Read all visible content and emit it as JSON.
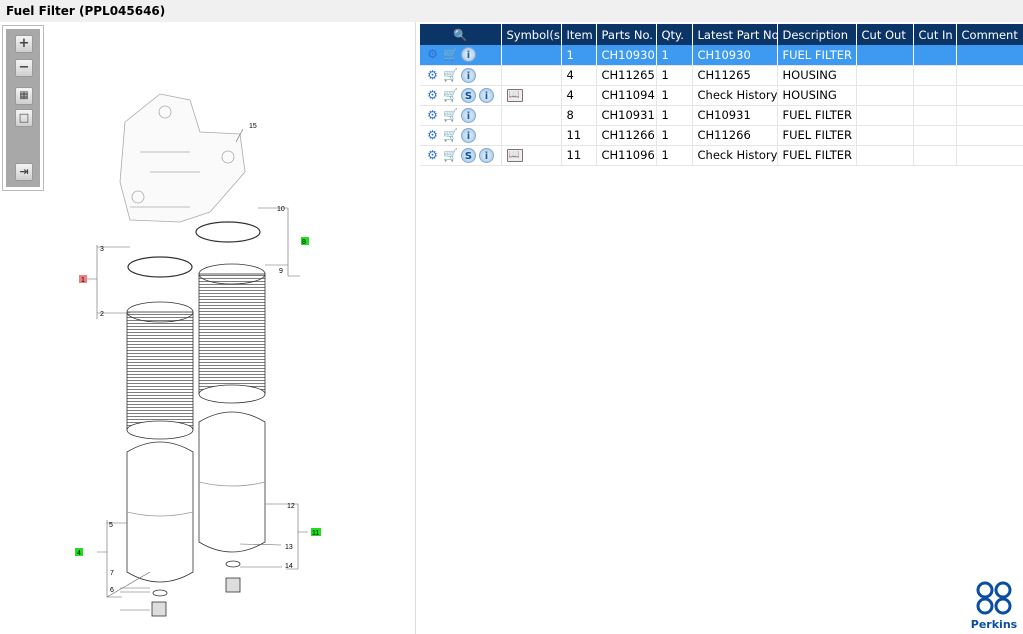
{
  "window": {
    "title": "Fuel Filter (PPL045646)"
  },
  "toolbar": {
    "zoom_in": "+",
    "zoom_out": "−",
    "fit": "▦",
    "actual": "□",
    "export": "⇥"
  },
  "table": {
    "columns": [
      "",
      "Symbol(s)",
      "Item",
      "Parts No.",
      "Qty.",
      "Latest Part No.",
      "Description",
      "Cut Out",
      "Cut In",
      "Comment"
    ],
    "rows": [
      {
        "selected": true,
        "s_icon": false,
        "symbol": false,
        "item": "1",
        "part": "CH10930",
        "qty": "1",
        "latest": "CH10930",
        "desc": "FUEL FILTER"
      },
      {
        "selected": false,
        "s_icon": false,
        "symbol": false,
        "item": "4",
        "part": "CH11265",
        "qty": "1",
        "latest": "CH11265",
        "desc": "HOUSING"
      },
      {
        "selected": false,
        "s_icon": true,
        "symbol": true,
        "item": "4",
        "part": "CH11094",
        "qty": "1",
        "latest": "Check History",
        "desc": "HOUSING"
      },
      {
        "selected": false,
        "s_icon": false,
        "symbol": false,
        "item": "8",
        "part": "CH10931",
        "qty": "1",
        "latest": "CH10931",
        "desc": "FUEL FILTER"
      },
      {
        "selected": false,
        "s_icon": false,
        "symbol": false,
        "item": "11",
        "part": "CH11266",
        "qty": "1",
        "latest": "CH11266",
        "desc": "FUEL FILTER HC"
      },
      {
        "selected": false,
        "s_icon": true,
        "symbol": true,
        "item": "11",
        "part": "CH11096",
        "qty": "1",
        "latest": "Check History",
        "desc": "FUEL FILTER HC"
      }
    ]
  },
  "callouts": [
    "15",
    "10",
    "3",
    "8",
    "1",
    "9",
    "2",
    "12",
    "5",
    "11",
    "4",
    "7",
    "13",
    "6",
    "14"
  ],
  "logo": {
    "text": "Perkins"
  },
  "colors": {
    "header": "#0c3567",
    "selected": "#3d9af0",
    "green_tag": "#22dd22",
    "red_tag": "#f08080",
    "brand": "#0a4ea0"
  }
}
